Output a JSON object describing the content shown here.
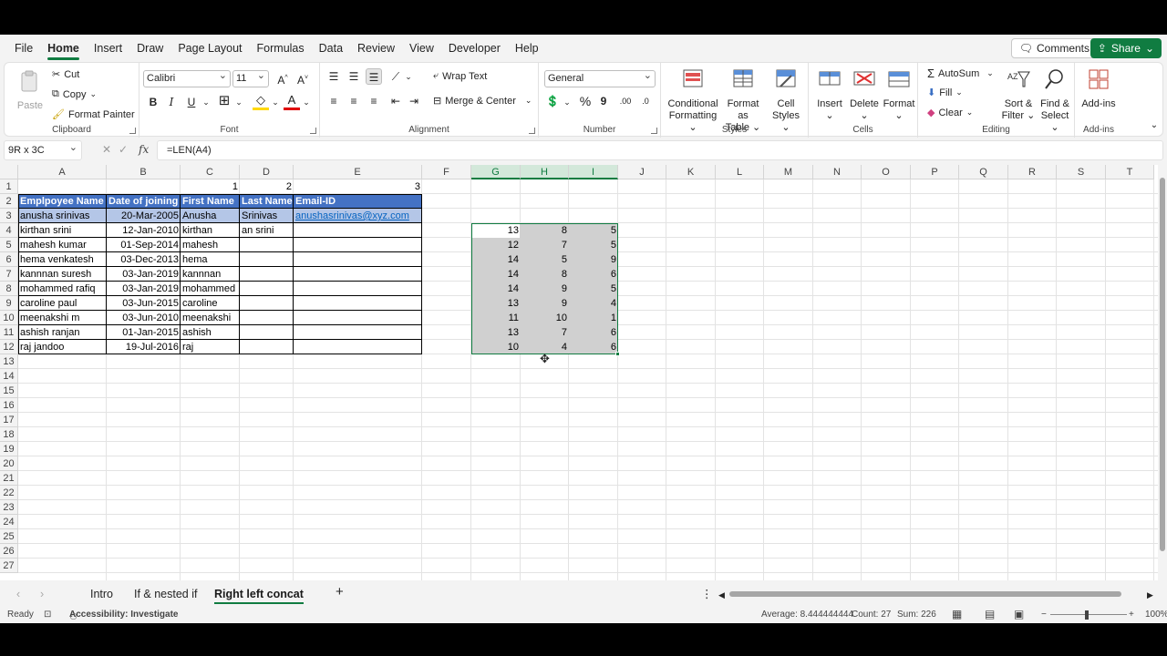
{
  "menu": {
    "tabs": [
      "File",
      "Home",
      "Insert",
      "Draw",
      "Page Layout",
      "Formulas",
      "Data",
      "Review",
      "View",
      "Developer",
      "Help"
    ],
    "active": "Home",
    "comments_label": "Comments",
    "share_label": "Share"
  },
  "ribbon": {
    "clipboard": {
      "paste": "Paste",
      "cut": "Cut",
      "copy": "Copy",
      "format_painter": "Format Painter",
      "label": "Clipboard"
    },
    "font": {
      "name": "Calibri",
      "size": "11",
      "grow": "A^",
      "shrink": "A˅",
      "bold": "B",
      "italic": "I",
      "underline": "U",
      "label": "Font"
    },
    "alignment": {
      "wrap_text": "Wrap Text",
      "merge_center": "Merge & Center",
      "label": "Alignment"
    },
    "number": {
      "format": "General",
      "label": "Number"
    },
    "styles": {
      "conditional": "Conditional",
      "formatting": "Formatting",
      "format_as": "Format as",
      "table": "Table",
      "cell": "Cell",
      "cell_styles": "Styles",
      "label": "Styles"
    },
    "cells": {
      "insert": "Insert",
      "delete": "Delete",
      "format": "Format",
      "label": "Cells"
    },
    "editing": {
      "autosum": "AutoSum",
      "fill": "Fill",
      "clear": "Clear",
      "sort": "Sort &",
      "filter": "Filter",
      "find": "Find &",
      "select": "Select",
      "label": "Editing"
    },
    "addins": {
      "addins": "Add-ins",
      "label": "Add-ins"
    }
  },
  "formula_bar": {
    "name_box": "9R x 3C",
    "formula": "=LEN(A4)"
  },
  "columns": [
    "A",
    "B",
    "C",
    "D",
    "E",
    "F",
    "G",
    "H",
    "I",
    "J",
    "K",
    "L",
    "M",
    "N",
    "O",
    "P",
    "Q",
    "R",
    "S",
    "T"
  ],
  "rows": [
    "1",
    "2",
    "3",
    "4",
    "5",
    "6",
    "7",
    "8",
    "9",
    "10",
    "11",
    "12",
    "13",
    "14",
    "15",
    "16",
    "17",
    "18",
    "19",
    "20",
    "21",
    "22",
    "23",
    "24",
    "25",
    "26",
    "27"
  ],
  "sheet": {
    "row1": {
      "c": "1",
      "d": "2",
      "e": "3"
    },
    "headers": [
      "Emplpoyee Name",
      "Date of joining",
      "First Name",
      "Last Name",
      "Email-ID"
    ],
    "records": [
      {
        "name": "anusha srinivas",
        "date": "20-Mar-2005",
        "first": "Anusha",
        "last": "Srinivas",
        "email": "anushasrinivas@xyz.com"
      },
      {
        "name": "kirthan srini",
        "date": "12-Jan-2010",
        "first": "kirthan",
        "last": "an srini",
        "email": ""
      },
      {
        "name": "mahesh kumar",
        "date": "01-Sep-2014",
        "first": "mahesh",
        "last": "",
        "email": ""
      },
      {
        "name": "hema venkatesh",
        "date": "03-Dec-2013",
        "first": "hema",
        "last": "",
        "email": ""
      },
      {
        "name": "kannnan suresh",
        "date": "03-Jan-2019",
        "first": "kannnan",
        "last": "",
        "email": ""
      },
      {
        "name": "mohammed rafiq",
        "date": "03-Jan-2019",
        "first": "mohammed",
        "last": "",
        "email": ""
      },
      {
        "name": "caroline paul",
        "date": "03-Jun-2015",
        "first": "caroline",
        "last": "",
        "email": ""
      },
      {
        "name": "meenakshi m",
        "date": "03-Jun-2010",
        "first": "meenakshi",
        "last": "",
        "email": ""
      },
      {
        "name": "ashish ranjan",
        "date": "01-Jan-2015",
        "first": "ashish",
        "last": "",
        "email": ""
      },
      {
        "name": "raj jandoo",
        "date": "19-Jul-2016",
        "first": "raj",
        "last": "",
        "email": ""
      }
    ],
    "numbers": [
      [
        "13",
        "8",
        "5"
      ],
      [
        "12",
        "7",
        "5"
      ],
      [
        "14",
        "5",
        "9"
      ],
      [
        "14",
        "8",
        "6"
      ],
      [
        "14",
        "9",
        "5"
      ],
      [
        "13",
        "9",
        "4"
      ],
      [
        "11",
        "10",
        "1"
      ],
      [
        "13",
        "7",
        "6"
      ],
      [
        "10",
        "4",
        "6"
      ]
    ]
  },
  "sheet_tabs": [
    "Intro",
    "If & nested if",
    "Right left concat"
  ],
  "active_sheet": "Right left concat",
  "status": {
    "ready": "Ready",
    "accessibility": "Accessibility: Investigate",
    "average": "Average: 8.444444444",
    "count": "Count: 27",
    "sum": "Sum: 226",
    "zoom": "100%"
  },
  "colors": {
    "accent": "#107c41",
    "header_fill": "#4472c4",
    "highlight_fill": "#b4c6e7",
    "link": "#0563c1"
  }
}
